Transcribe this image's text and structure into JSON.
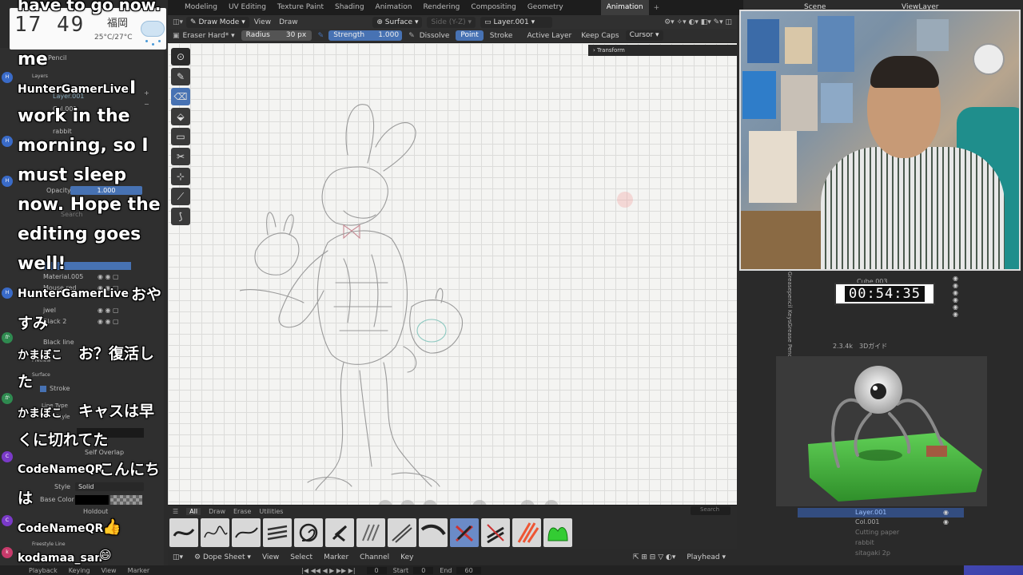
{
  "workspace_tabs": [
    "Modeling",
    "UV Editing",
    "Texture Paint",
    "Shading",
    "Animation",
    "Rendering",
    "Compositing",
    "Geometry",
    "Animation"
  ],
  "active_tab_index": 8,
  "header": {
    "mode": "Draw Mode",
    "view": "View",
    "draw": "Draw",
    "surface": "Surface",
    "side": "Side (Y-Z)",
    "layer": "Layer.001"
  },
  "tool_settings": {
    "brush": "Eraser Hard*",
    "radius_label": "Radius",
    "radius_value": "30 px",
    "strength_label": "Strength",
    "strength_value": "1.000",
    "dissolve": "Dissolve",
    "point": "Point",
    "stroke": "Stroke",
    "active_layer": "Active Layer",
    "keep_caps": "Keep Caps",
    "cursor": "Cursor"
  },
  "viewport": {
    "transform_panel": "Transform"
  },
  "brush_bar": {
    "tabs": [
      "All",
      "Draw",
      "Erase",
      "Utilities"
    ],
    "active_tab": 0,
    "search_placeholder": "Search"
  },
  "dopesheet": {
    "editor": "Dope Sheet",
    "menu": [
      "View",
      "Select",
      "Marker",
      "Channel",
      "Key"
    ],
    "playhead": "Playhead"
  },
  "playbar": {
    "items": [
      "Playback",
      "Keying",
      "View",
      "Marker"
    ],
    "frame": "0",
    "start_label": "Start",
    "start_value": "0",
    "end_label": "End",
    "end_value": "60"
  },
  "left_panel": {
    "pencil": "Pencil",
    "layers": "Layers",
    "layer_items": [
      "Layer.001",
      "Col.001",
      "rabbit"
    ],
    "opacity_label": "Opacity",
    "opacity_value": "1.000",
    "search_placeholder": "Search",
    "material_items": [
      "Black line",
      "Material.005",
      "Mouse red",
      "jwel",
      "Black 2"
    ],
    "preview": "Preview",
    "surface": "Surface",
    "stroke": "Stroke",
    "line_type": "Line Type",
    "style_label": "Style",
    "style_value": "Solid",
    "self_overlap": "Self Overlap",
    "base_color": "Base Color",
    "holdout": "Holdout",
    "freestyle_line": "Freestyle Line"
  },
  "clock": {
    "time": "17 49",
    "city": "福岡",
    "temp": "25°C/27°C"
  },
  "chat": {
    "top_fragment": "have to go now.",
    "message_1_lead": "me",
    "message_2_user": "HunterGamerLive",
    "message_2_text": [
      "I",
      "work in the",
      "morning, so I",
      "must sleep",
      "now. Hope the",
      "editing goes",
      "well!"
    ],
    "message_3_user": "HunterGamerLive",
    "message_3_text": [
      "おや",
      "すみ"
    ],
    "message_4_user": "かまぼこ",
    "message_4_text": [
      "お？復活し",
      "た"
    ],
    "message_5_user": "かまぼこ",
    "message_5_text": [
      "キャスは早",
      "くに切れてた"
    ],
    "message_6_user": "CodeNameQR",
    "message_6_text": [
      "こんにち",
      "は"
    ],
    "message_7_user": "CodeNameQR",
    "message_7_text": "👍",
    "message_8_user": "kodamaa_san",
    "message_8_text": "😄"
  },
  "right_panel": {
    "scene": "Scene",
    "view_layer": "ViewLayer",
    "outliner_top": [
      "Cube.003",
      "2.3.4k　3Dガイド"
    ],
    "vertical_labels": [
      "Greasepencil Keys",
      "Grease Pencil"
    ],
    "timer": "00:54:35",
    "outliner_bottom": [
      "Layer.001",
      "Col.001",
      "Cutting paper",
      "rabbit",
      "sitagaki 2p"
    ]
  },
  "colors": {
    "accent_blue": "#4772b3",
    "viewport_bg": "#f4f4f2",
    "ground_green": "#4bb842"
  }
}
